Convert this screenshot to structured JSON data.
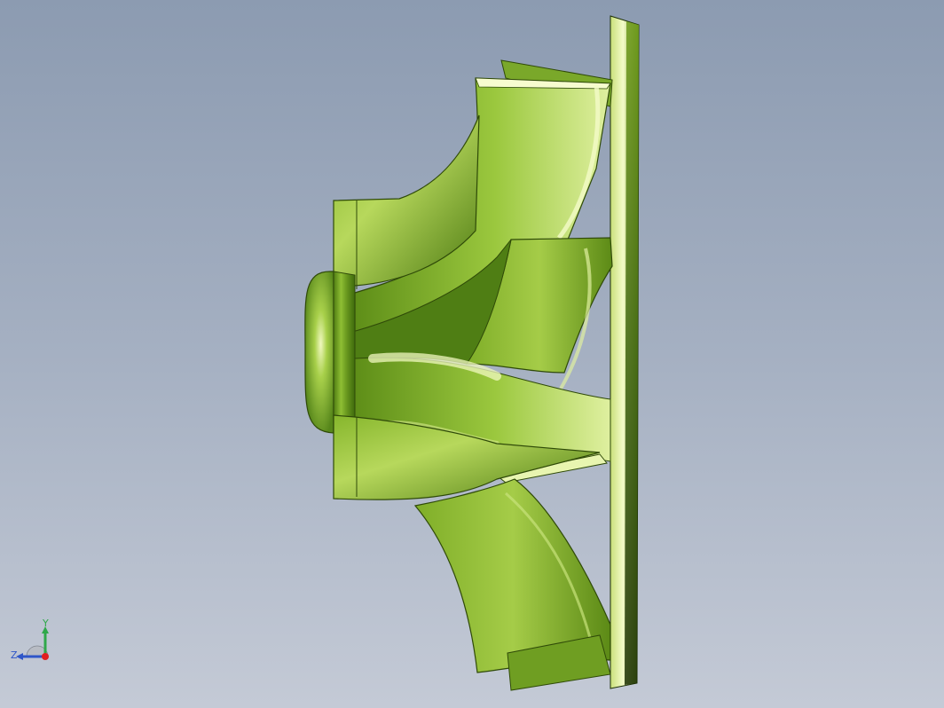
{
  "viewport": {
    "background_top": "#8c9bb1",
    "background_bottom": "#c4cad6"
  },
  "model": {
    "icon": "impeller-3d-model",
    "color": "#6b9a1f",
    "highlight": "#e8f5a8",
    "shadow": "#2f4a08"
  },
  "triad": {
    "y_label": "Y",
    "z_label": "Z",
    "y_color": "#2fa84a",
    "z_color": "#2f56c8",
    "x_color": "#e02020"
  }
}
